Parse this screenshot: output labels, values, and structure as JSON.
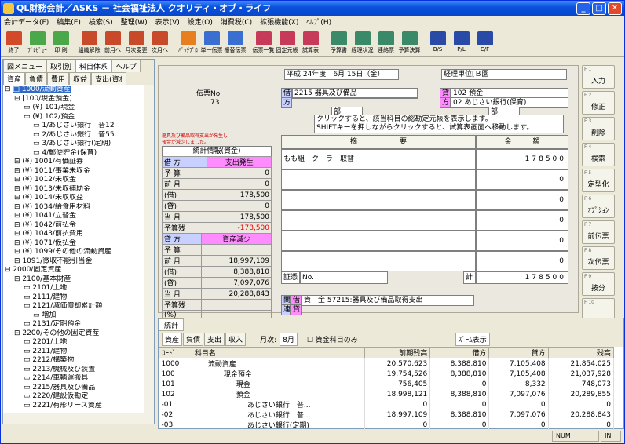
{
  "title": "QL財務会計／ASKS － 社会福祉法人 クオリティ・オブ・ライフ",
  "menu": [
    "会計データ(F)",
    "編集(E)",
    "検索(S)",
    "整理(W)",
    "表示(V)",
    "設定(O)",
    "消費税(C)",
    "拡張機能(X)",
    "ﾍﾙﾌﾟ(H)"
  ],
  "toolbar": [
    {
      "label": "終了",
      "color": "#d24a2a"
    },
    {
      "label": "ﾌﾟﾚﾋﾞｭｰ",
      "color": "#4aa84a"
    },
    {
      "label": "印 刷",
      "color": "#4aa84a"
    },
    {
      "label": "組織解除",
      "color": "#c84a2a"
    },
    {
      "label": "前月へ",
      "color": "#c84a2a"
    },
    {
      "label": "月次変更",
      "color": "#c84a2a"
    },
    {
      "label": "次月へ",
      "color": "#c84a2a"
    },
    {
      "label": "ﾊﾞｯﾁﾌﾟﾛ",
      "color": "#e87f1e"
    },
    {
      "label": "単一伝票",
      "color": "#3a6ed0"
    },
    {
      "label": "振替伝票",
      "color": "#3a6ed0"
    },
    {
      "label": "伝票一覧",
      "color": "#c83a5a"
    },
    {
      "label": "固定元帳",
      "color": "#c83a5a"
    },
    {
      "label": "試算表",
      "color": "#c83a5a"
    },
    {
      "label": "予算書",
      "color": "#3a8a6a"
    },
    {
      "label": "経理状況",
      "color": "#3a8a6a"
    },
    {
      "label": "連絡票",
      "color": "#3a8a6a"
    },
    {
      "label": "予算決算",
      "color": "#3a8a6a"
    },
    {
      "label": "B/S",
      "color": "#2a4aa8"
    },
    {
      "label": "P/L",
      "color": "#2a4aa8"
    },
    {
      "label": "C/F",
      "color": "#2a4aa8"
    }
  ],
  "left": {
    "tabs1": [
      "図メニュー",
      "取引別",
      "科目体系",
      "ヘルプ"
    ],
    "tabs2": [
      "資産",
      "負債",
      "費用",
      "収益",
      "支出(資ｵ"
    ],
    "tree": [
      {
        "t": "□ 1000/流動資産",
        "d": 0,
        "sel": true
      },
      {
        "t": "[100/現金預金]",
        "d": 1
      },
      {
        "t": "(¥) 101/現金",
        "d": 2
      },
      {
        "t": "(¥) 102/預金",
        "d": 2
      },
      {
        "t": "1/あじさい銀行　普12",
        "d": 3
      },
      {
        "t": "2/あじさい銀行　普55",
        "d": 3
      },
      {
        "t": "3/あじさい銀行(定期)",
        "d": 3
      },
      {
        "t": "4/郵便貯金(保育)",
        "d": 3
      },
      {
        "t": "(¥) 1001/有価証券",
        "d": 1
      },
      {
        "t": "(¥) 1011/事業未収金",
        "d": 1
      },
      {
        "t": "(¥) 1012/未収金",
        "d": 1
      },
      {
        "t": "(¥) 1013/未収補助金",
        "d": 1
      },
      {
        "t": "(¥) 1014/未収収益",
        "d": 1
      },
      {
        "t": "(¥) 1034/給食用材料",
        "d": 1
      },
      {
        "t": "(¥) 1041/立替金",
        "d": 1
      },
      {
        "t": "(¥) 1042/前払金",
        "d": 1
      },
      {
        "t": "(¥) 1043/前払費用",
        "d": 1
      },
      {
        "t": "(¥) 1071/仮払金",
        "d": 1
      },
      {
        "t": "(¥) 1099/その他の流動資産",
        "d": 1
      },
      {
        "t": "1091/徴収不能引当金",
        "d": 1
      },
      {
        "t": "2000/固定資産",
        "d": 0
      },
      {
        "t": "2100/基本財産",
        "d": 1
      },
      {
        "t": "2101/土地",
        "d": 2
      },
      {
        "t": "2111/建物",
        "d": 2
      },
      {
        "t": "2121/減価償却累計額",
        "d": 2
      },
      {
        "t": "増加",
        "d": 3
      },
      {
        "t": "2131/定期預金",
        "d": 2
      },
      {
        "t": "2200/その他の固定資産",
        "d": 1
      },
      {
        "t": "2201/土地",
        "d": 2
      },
      {
        "t": "2211/建物",
        "d": 2
      },
      {
        "t": "2212/構築物",
        "d": 2
      },
      {
        "t": "2213/機械及び装置",
        "d": 2
      },
      {
        "t": "2214/車輌運搬具",
        "d": 2
      },
      {
        "t": "2215/器具及び備品",
        "d": 2
      },
      {
        "t": "2220/建設仮勘定",
        "d": 2
      },
      {
        "t": "2221/有形リース資産",
        "d": 2
      }
    ]
  },
  "form": {
    "date": "平成 24年度　6月 15日（金）",
    "unit": "経理単位[Ｂ園",
    "denpyo_label": "伝票No.",
    "denpyo_no": "73",
    "kari": "借",
    "kari_code": "2215",
    "kari_name": "器具及び備品",
    "kata": "方",
    "kashi": "貸",
    "kashi_code": "102",
    "kashi_name": "預金",
    "kashi2": "02",
    "kashi2_name": "あじさい銀行(保育)",
    "bu": "部",
    "note1": "クリックすると、該当科目の総勘定元帳を表示します。",
    "note2": "SHIFTキーを押しながらクリックすると、試算表画面へ移動します。",
    "warn1": "器具及び備品取得支出が発生し",
    "warn2": "預金が減少しました。",
    "stat_title": "統計情報(資金)",
    "b_head": "借 方",
    "b_head2": "支出発生",
    "c_head": "貸 方",
    "c_head2": "資産減少",
    "stats1": [
      [
        "予 算",
        "0"
      ],
      [
        "前 月",
        "0"
      ],
      [
        "(借)",
        "178,500"
      ],
      [
        "(貸)",
        "0"
      ],
      [
        "当 月",
        "178,500"
      ],
      [
        "予算残",
        "-178,500"
      ],
      [
        "(%)",
        "(*****%)"
      ]
    ],
    "stats2": [
      [
        "予 算",
        ""
      ],
      [
        "前 月",
        "18,997,109"
      ],
      [
        "(借)",
        "8,388,810"
      ],
      [
        "(貸)",
        "7,097,076"
      ],
      [
        "当 月",
        "20,288,843"
      ],
      [
        "予算残",
        ""
      ],
      [
        "(%)",
        ""
      ]
    ],
    "tekiyo": "摘　　　　　　要",
    "kingaku": "金　　　額",
    "line1": "もも組　クーラー取替",
    "amt1": "178500",
    "zero": "0",
    "shoryo": "証憑",
    "no": "No.",
    "kei": "計",
    "total": "178500",
    "kan": "関",
    "ren": "連",
    "kan_kari": "借",
    "kan_kashi": "貸",
    "kan_text": "資　金  57215:器具及び備品取得支出"
  },
  "fkeys": [
    [
      "F 1",
      "入力"
    ],
    [
      "F 2",
      "修正"
    ],
    [
      "F 3",
      "削除"
    ],
    [
      "F 4",
      "検索"
    ],
    [
      "F 5",
      "定型化"
    ],
    [
      "F 6",
      "ｵﾌﾟｼｮﾝ"
    ],
    [
      "F 7",
      "前伝票"
    ],
    [
      "F 8",
      "次伝票"
    ],
    [
      "F 9",
      "按分"
    ],
    [
      "F 10",
      ""
    ],
    [
      "F 11",
      ""
    ],
    [
      "F 12",
      ""
    ]
  ],
  "bottom": {
    "tab": "統計",
    "tabs": [
      "資産",
      "負債",
      "支出",
      "収入"
    ],
    "month_label": "月次:",
    "month": "8月",
    "check": "資金科目のみ",
    "zoom": "ｽﾞｰﾑ表示",
    "headers": [
      "ｺｰﾄﾞ",
      "科目名",
      "前期残高",
      "借方",
      "貸方",
      "残高"
    ],
    "rows": [
      [
        "1000",
        "流動資産",
        "20,570,623",
        "8,388,810",
        "7,105,408",
        "21,854,025"
      ],
      [
        "100",
        "現金預金",
        "19,754,526",
        "8,388,810",
        "7,105,408",
        "21,037,928"
      ],
      [
        "101",
        "現金",
        "756,405",
        "0",
        "8,332",
        "748,073"
      ],
      [
        "102",
        "預金",
        "18,998,121",
        "8,388,810",
        "7,097,076",
        "20,289,855"
      ],
      [
        "-01",
        "あじさい銀行　普...",
        "0",
        "0",
        "0",
        "0"
      ],
      [
        "-02",
        "あじさい銀行　普...",
        "18,997,109",
        "8,388,810",
        "7,097,076",
        "20,288,843"
      ],
      [
        "-03",
        "あじさい銀行(定期)",
        "0",
        "0",
        "0",
        "0"
      ]
    ]
  },
  "status": {
    "num": "NUM",
    "in": "IN"
  }
}
